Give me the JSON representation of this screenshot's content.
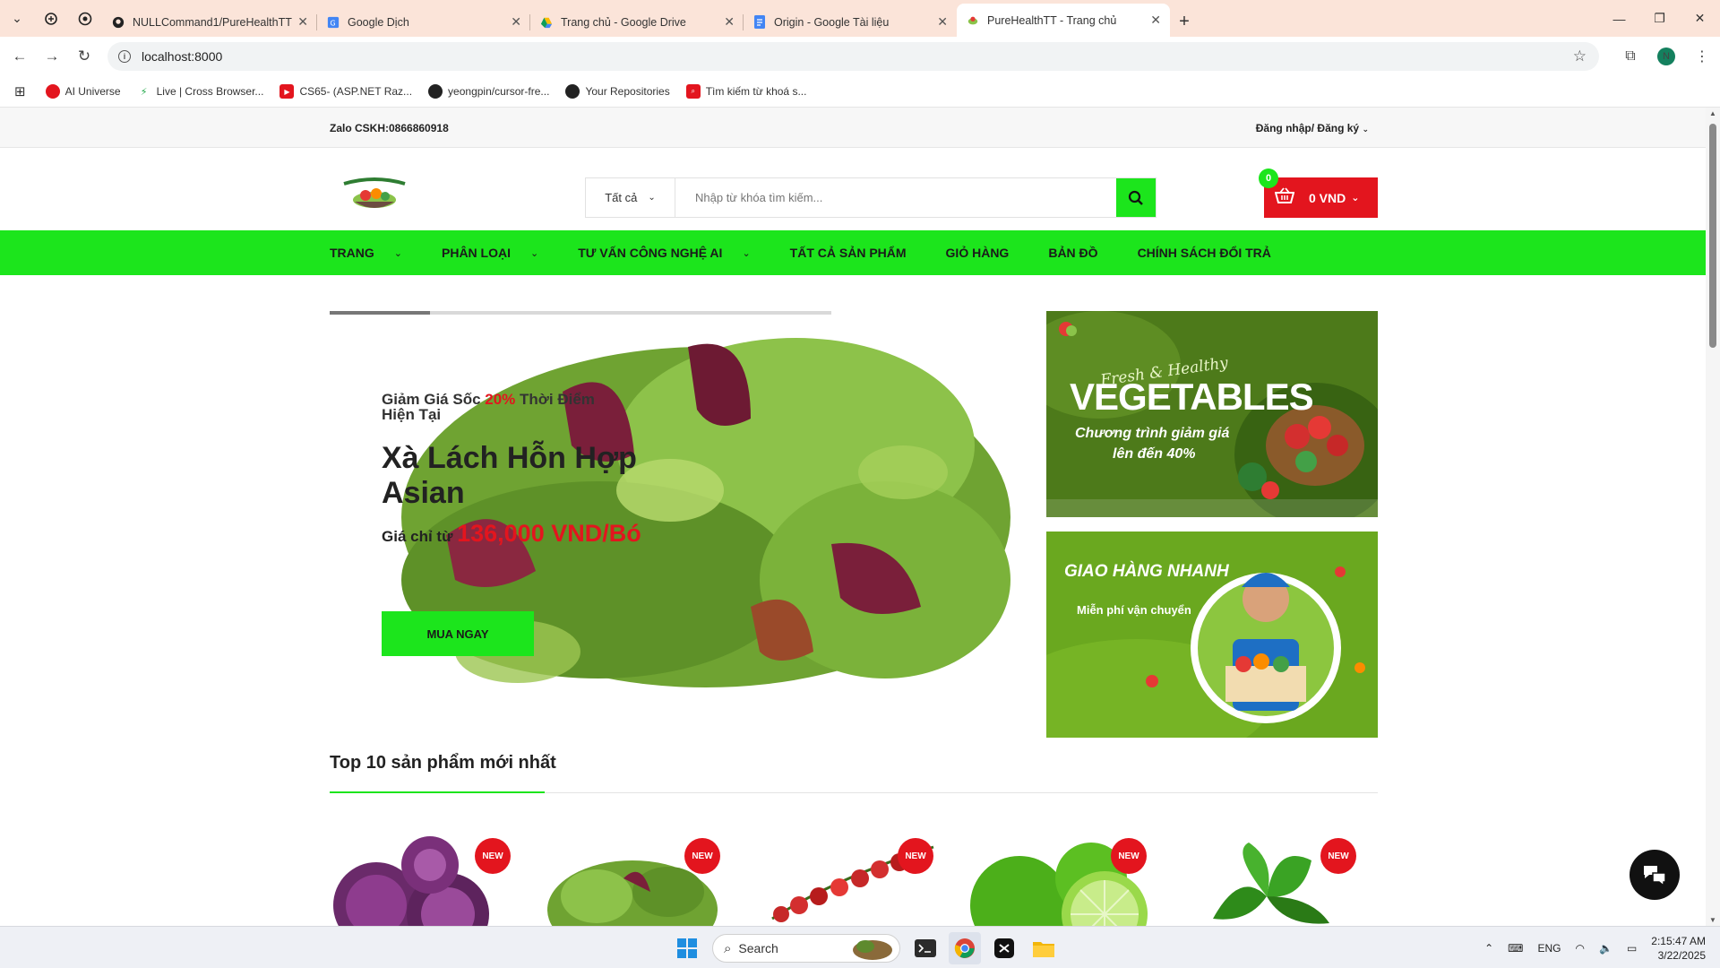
{
  "browser": {
    "tabs": [
      {
        "title": "NULLCommand1/PureHealthTT",
        "icon": "github-icon"
      },
      {
        "title": "Google Dịch",
        "icon": "google-translate-icon"
      },
      {
        "title": "Trang chủ - Google Drive",
        "icon": "google-drive-icon"
      },
      {
        "title": "Origin - Google Tài liệu",
        "icon": "google-docs-icon"
      },
      {
        "title": "PureHealthTT - Trang chủ",
        "icon": "leaf-icon"
      }
    ],
    "url": "localhost:8000",
    "profile_initial": "N",
    "bookmarks": [
      {
        "label": "AI Universe"
      },
      {
        "label": "Live | Cross Browser..."
      },
      {
        "label": "CS65- (ASP.NET Raz..."
      },
      {
        "label": "yeongpin/cursor-fre..."
      },
      {
        "label": "Your Repositories"
      },
      {
        "label": "Tìm kiếm từ khoá s..."
      }
    ]
  },
  "site": {
    "topbar": {
      "hotline": "Zalo CSKH:0866860918",
      "login": "Đăng nhập/ Đăng ký"
    },
    "search": {
      "category": "Tất cả",
      "placeholder": "Nhập từ khóa tìm kiếm..."
    },
    "cart": {
      "count": "0",
      "total": "0 VND"
    },
    "nav": [
      {
        "label": "TRANG",
        "has_dropdown": true
      },
      {
        "label": "PHÂN LOẠI",
        "has_dropdown": true
      },
      {
        "label": "TƯ VẤN CÔNG NGHỆ AI",
        "has_dropdown": true
      },
      {
        "label": "TẤT CẢ SẢN PHẨM",
        "has_dropdown": false
      },
      {
        "label": "GIỎ HÀNG",
        "has_dropdown": false
      },
      {
        "label": "BẢN ĐỒ",
        "has_dropdown": false
      },
      {
        "label": "CHÍNH SÁCH ĐỔI TRẢ",
        "has_dropdown": false
      }
    ],
    "hero": {
      "promo_before": "Giảm Giá Sốc ",
      "promo_pct": "20%",
      "promo_after": " Thời Điểm Hiện Tại",
      "product_name": "Xà Lách Hỗn Hợp Asian",
      "price_prefix": "Giá chỉ từ ",
      "price": "136,000 VND/Bó",
      "button": "MUA NGAY",
      "slide_progress": 0.2
    },
    "banners": {
      "vegetables": {
        "script": "Fresh & Healthy",
        "title": "VEGETABLES",
        "line1": "Chương trình giảm giá",
        "line2": "lên đến 40%"
      },
      "delivery": {
        "title": "GIAO HÀNG NHANH",
        "subtitle": "Miễn phí vận chuyển"
      }
    },
    "section": {
      "title": "Top 10 sản phẩm mới nhất"
    },
    "products": [
      {
        "badge": "NEW",
        "image": "red-cabbage"
      },
      {
        "badge": "NEW",
        "image": "mixed-salad"
      },
      {
        "badge": "NEW",
        "image": "cherry-tomatoes"
      },
      {
        "badge": "NEW",
        "image": "limes"
      },
      {
        "badge": "NEW",
        "image": "basil"
      }
    ]
  },
  "taskbar": {
    "search_label": "Search",
    "language": "ENG",
    "time": "2:15:47 AM",
    "date": "3/22/2025"
  },
  "colors": {
    "brand_green": "#1ce51c",
    "brand_red": "#e3151e"
  }
}
